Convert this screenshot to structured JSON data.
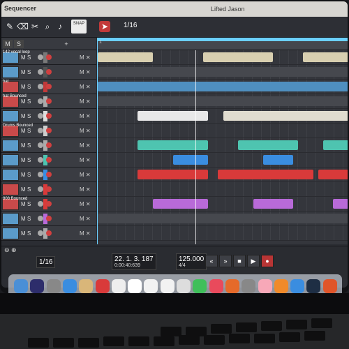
{
  "app": {
    "title": "Sequencer",
    "song": "Lifted Jason"
  },
  "toolbar": {
    "tools": [
      "pencil-icon",
      "eraser-icon",
      "knife-icon",
      "glue-icon",
      "zoom-icon",
      "speaker-icon"
    ],
    "snap_label": "SNAP",
    "grid_value": "1/16"
  },
  "header": {
    "buttons": [
      "M",
      "S",
      "+"
    ]
  },
  "tracks": [
    {
      "name": "142 vocal loop",
      "mute": "M",
      "solo": "S",
      "color": "#7a7a7a",
      "thumb": "blue"
    },
    {
      "name": "",
      "mute": "M",
      "solo": "S",
      "color": "#555",
      "thumb": "blue"
    },
    {
      "name": "hat",
      "mute": "M",
      "solo": "S",
      "color": "#c23a3a",
      "thumb": "red"
    },
    {
      "name": "hat Bounced",
      "mute": "M",
      "solo": "S",
      "color": "#aaa",
      "thumb": "red"
    },
    {
      "name": "",
      "mute": "M",
      "solo": "S",
      "color": "#ddd",
      "thumb": "blue"
    },
    {
      "name": "Drums Bounced",
      "mute": "M",
      "solo": "S",
      "color": "#ccc",
      "thumb": "red"
    },
    {
      "name": "",
      "mute": "M",
      "solo": "S",
      "color": "#aaa",
      "thumb": "blue"
    },
    {
      "name": "",
      "mute": "M",
      "solo": "S",
      "color": "#4ec4b0",
      "thumb": "blue"
    },
    {
      "name": "",
      "mute": "M",
      "solo": "S",
      "color": "#3a8de0",
      "thumb": "blue"
    },
    {
      "name": "",
      "mute": "M",
      "solo": "S",
      "color": "#d93a3a",
      "thumb": "red"
    },
    {
      "name": "808 Bounced",
      "mute": "M",
      "solo": "S",
      "color": "#d93a3a",
      "thumb": "red"
    },
    {
      "name": "",
      "mute": "M",
      "solo": "S",
      "color": "#b86ad8",
      "thumb": "blue"
    },
    {
      "name": "",
      "mute": "M",
      "solo": "S",
      "color": "#aaa",
      "thumb": "blue"
    }
  ],
  "ruler": {
    "bars": [
      "1",
      "",
      "",
      "",
      "",
      "",
      "",
      "",
      "",
      "",
      "",
      "",
      ""
    ]
  },
  "lanes": [
    {
      "clips": [
        {
          "start": 0.0,
          "end": 0.22,
          "color": "#d8cfb0"
        },
        {
          "start": 0.42,
          "end": 0.7,
          "color": "#d8cfb0"
        },
        {
          "start": 0.82,
          "end": 1.0,
          "color": "#d8cfb0"
        }
      ]
    },
    {
      "clips": [
        {
          "start": 0.0,
          "end": 1.0,
          "color": "#46484e"
        }
      ]
    },
    {
      "clips": [
        {
          "start": 0.0,
          "end": 1.0,
          "color": "#4f8fc0"
        }
      ]
    },
    {
      "clips": [
        {
          "start": 0.0,
          "end": 1.0,
          "color": "#46484e"
        }
      ]
    },
    {
      "clips": [
        {
          "start": 0.16,
          "end": 0.44,
          "color": "#e8e8e8"
        },
        {
          "start": 0.5,
          "end": 1.0,
          "color": "#e0dccf"
        }
      ]
    },
    {
      "clips": []
    },
    {
      "clips": [
        {
          "start": 0.16,
          "end": 0.44,
          "color": "#4ec4b0"
        },
        {
          "start": 0.56,
          "end": 0.8,
          "color": "#4ec4b0"
        },
        {
          "start": 0.9,
          "end": 1.0,
          "color": "#4ec4b0"
        }
      ]
    },
    {
      "clips": [
        {
          "start": 0.3,
          "end": 0.44,
          "color": "#3a8de0"
        },
        {
          "start": 0.66,
          "end": 0.78,
          "color": "#3a8de0"
        }
      ]
    },
    {
      "clips": [
        {
          "start": 0.16,
          "end": 0.44,
          "color": "#d93a3a"
        },
        {
          "start": 0.48,
          "end": 0.86,
          "color": "#d93a3a"
        },
        {
          "start": 0.88,
          "end": 1.0,
          "color": "#d93a3a"
        }
      ]
    },
    {
      "clips": []
    },
    {
      "clips": [
        {
          "start": 0.22,
          "end": 0.44,
          "color": "#b86ad8"
        },
        {
          "start": 0.62,
          "end": 0.78,
          "color": "#b86ad8"
        },
        {
          "start": 0.94,
          "end": 1.0,
          "color": "#b86ad8"
        }
      ]
    },
    {
      "clips": [
        {
          "start": 0.0,
          "end": 1.0,
          "color": "#46484e"
        }
      ]
    },
    {
      "clips": []
    }
  ],
  "transport": {
    "grid": "1/16",
    "position_bars": "22. 1. 3. 187",
    "position_time": "0:00:40:639",
    "tempo": "125.000",
    "time_sig": "4/4"
  },
  "dock": {
    "icons": [
      {
        "name": "finder-icon",
        "color": "#4a8fd6"
      },
      {
        "name": "siri-icon",
        "color": "#2d2d6b"
      },
      {
        "name": "launchpad-icon",
        "color": "#888"
      },
      {
        "name": "safari-icon",
        "color": "#3a8de0"
      },
      {
        "name": "mail-icon",
        "color": "#d9b679"
      },
      {
        "name": "opera-icon",
        "color": "#d93a3a"
      },
      {
        "name": "photos-icon",
        "color": "#eee"
      },
      {
        "name": "calendar-icon",
        "color": "#fff"
      },
      {
        "name": "notes-icon",
        "color": "#f2f2f2"
      },
      {
        "name": "reminders-icon",
        "color": "#f2f2f2"
      },
      {
        "name": "preview-icon",
        "color": "#ddd"
      },
      {
        "name": "messages-icon",
        "color": "#3fbf5a"
      },
      {
        "name": "music-icon",
        "color": "#e94a5c"
      },
      {
        "name": "firefox-icon",
        "color": "#e56a2a"
      },
      {
        "name": "system-prefs-icon",
        "color": "#888"
      },
      {
        "name": "itunes-icon",
        "color": "#f7a8b8"
      },
      {
        "name": "books-icon",
        "color": "#f08a2a"
      },
      {
        "name": "appstore-icon",
        "color": "#3a8de0"
      },
      {
        "name": "steam-icon",
        "color": "#1e2e44"
      },
      {
        "name": "ubuntu-icon",
        "color": "#e0552a"
      }
    ]
  }
}
